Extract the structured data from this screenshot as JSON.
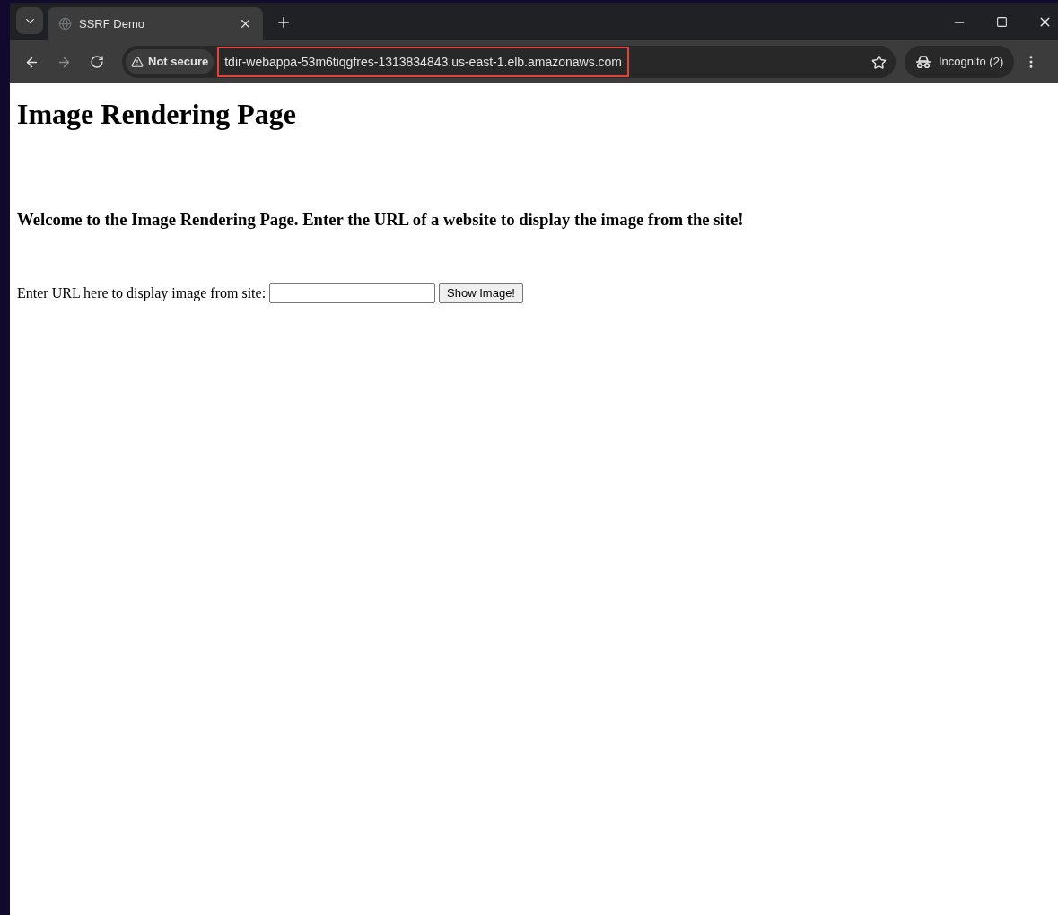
{
  "tab": {
    "title": "SSRF Demo",
    "selected": true
  },
  "toolbar": {
    "security": "Not secure",
    "url": "tdir-webappa-53m6tiqgfres-1313834843.us-east-1.elb.amazonaws.com",
    "url_highlighted": true,
    "profile": "Incognito (2)"
  },
  "page": {
    "heading": "Image Rendering Page",
    "welcome": "Welcome to the Image Rendering Page. Enter the URL of a website to display the image from the site!",
    "form_label": "Enter URL here to display image from site:",
    "button": "Show Image!"
  }
}
